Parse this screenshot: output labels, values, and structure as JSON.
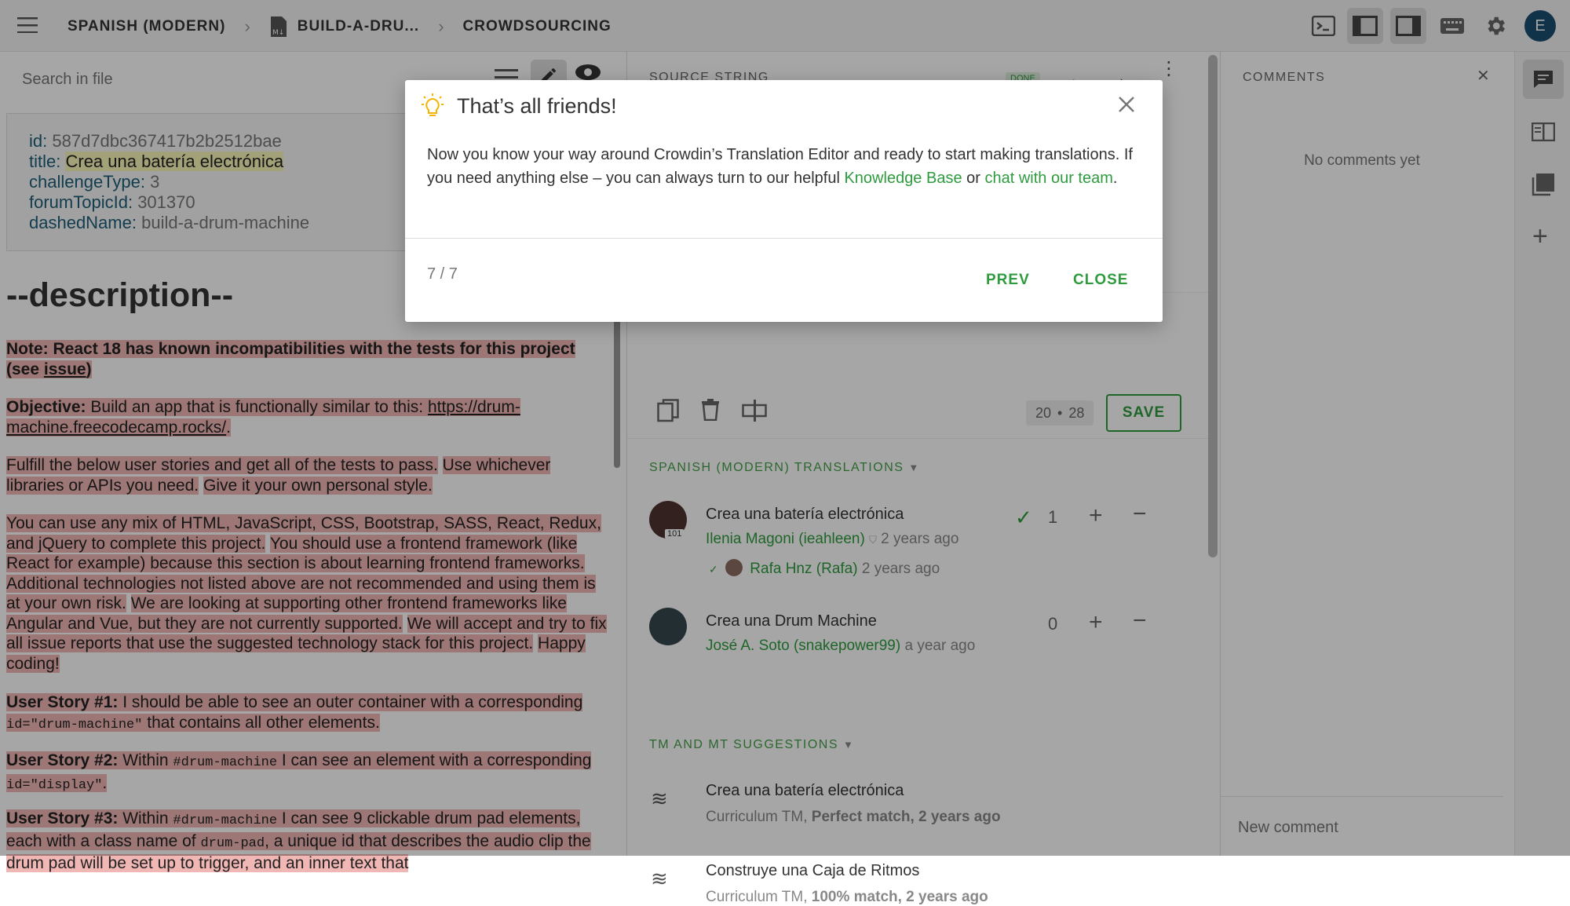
{
  "topbar": {
    "menu_icon": "hamburger-menu-icon",
    "crumb1": "SPANISH (MODERN)",
    "crumb2": "BUILD-A-DRU...",
    "crumb3": "CROWDSOURCING",
    "avatar_letter": "E"
  },
  "left": {
    "search_placeholder": "Search in file",
    "meta": {
      "id_key": "id:",
      "id_val": "587d7dbc367417b2b2512bae",
      "title_key": "title:",
      "title_val": "Crea una batería electrónica",
      "ctype_key": "challengeType:",
      "ctype_val": "3",
      "forum_key": "forumTopicId:",
      "forum_val": "301370",
      "dashed_key": "dashedName:",
      "dashed_val": "build-a-drum-machine"
    },
    "heading": "--description--",
    "note_a": "Note: React 18 has known incompatibilities with the tests for this project (see ",
    "note_link": "issue",
    "note_b": ")",
    "obj_label": "Objective:",
    "obj_text": " Build an app that is functionally similar to this: ",
    "obj_link": "https://drum-machine.freecodecamp.rocks/",
    "obj_end": ".",
    "fulfill_1": "Fulfill the below user stories and get all of the tests to pass.",
    "fulfill_2": "Use whichever libraries or APIs you need.",
    "fulfill_3": "Give it your own personal style.",
    "mix_1": "You can use any mix of HTML, JavaScript, CSS, Bootstrap, SASS, React, Redux, and jQuery to complete this project.",
    "mix_2": "You should use a frontend framework (like React for example) because this section is about learning frontend frameworks.",
    "mix_3": "Additional technologies not listed above are not recommended and using them is at your own risk.",
    "mix_4": "We are looking at supporting other frontend frameworks like Angular and Vue, but they are not currently supported.",
    "mix_5": "We will accept and try to fix all issue reports that use the suggested technology stack for this project.",
    "mix_6": "Happy coding!",
    "us1_label": "User Story #1:",
    "us1_a": " I should be able to see an outer container with a corresponding ",
    "us1_code": "id=\"drum-machine\"",
    "us1_b": " that contains all other elements.",
    "us2_label": "User Story #2:",
    "us2_a": " Within ",
    "us2_code1": "#drum-machine",
    "us2_b": " I can see an element with a corresponding ",
    "us2_code2": "id=\"display\"",
    "us2_c": ".",
    "us3_label": "User Story #3:",
    "us3_a": " Within ",
    "us3_code1": "#drum-machine",
    "us3_b": " I can see 9 clickable drum pad elements, each with a class name of ",
    "us3_code2": "drum-pad",
    "us3_c": ", a unique id that describes the audio clip the drum pad will be set up to trigger, and an inner text that"
  },
  "mid": {
    "source_label": "SOURCE STRING",
    "done_badge": "DONE",
    "counter_a": "20",
    "counter_dot": "•",
    "counter_b": "28",
    "save_label": "SAVE",
    "translations_label": "SPANISH (MODERN) TRANSLATIONS",
    "translations": [
      {
        "text": "Crea una batería electrónica",
        "author": "Ilenia Magoni (ieahleen)",
        "time": "2 years ago",
        "votes": "1",
        "badge": "101",
        "approver": "Rafa Hnz (Rafa)",
        "approver_time": "2 years ago"
      },
      {
        "text": "Crea una Drum Machine",
        "author": "José A. Soto (snakepower99)",
        "time": "a year ago",
        "votes": "0"
      }
    ],
    "tm_label": "TM AND MT SUGGESTIONS",
    "suggestions": [
      {
        "text": "Crea una batería electrónica",
        "source": "Curriculum TM, ",
        "match": "Perfect match, 2 years ago"
      },
      {
        "text": "Construye una Caja de Ritmos",
        "source": "Curriculum TM, ",
        "match": "100% match, 2 years ago"
      }
    ]
  },
  "right": {
    "comments_label": "COMMENTS",
    "no_comments": "No comments yet",
    "new_comment_placeholder": "New comment"
  },
  "modal": {
    "title": "That’s all friends!",
    "body_a": "Now you know your way around Crowdin’s Translation Editor and ready to start making translations. If you need anything else – you can always turn to our helpful ",
    "link1": "Knowledge Base",
    "body_b": " or ",
    "link2": "chat with our team",
    "body_c": ".",
    "step": "7 / 7",
    "prev": "PREV",
    "close": "CLOSE"
  },
  "colors": {
    "accent": "#2e9b3e",
    "highlight": "#f1b7b5",
    "title_highlight": "#fbf7b8"
  }
}
